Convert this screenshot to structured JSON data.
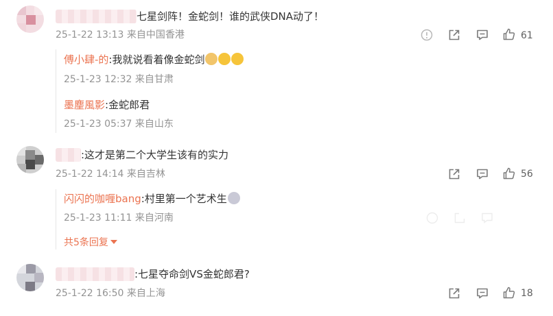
{
  "comments": [
    {
      "text": "七星剑阵！金蛇剑！谁的武侠DNA动了！",
      "meta": "25-1-22 13:13 来自中国香港",
      "likes": "61",
      "replies": [
        {
          "name": "傅小肆-的",
          "text": ":我就说看着像金蛇剑",
          "meta": "25-1-23 12:32 来自甘肃"
        },
        {
          "name": "墨麈風影",
          "text": ":金蛇郎君",
          "meta": "25-1-23 05:37 来自山东"
        }
      ]
    },
    {
      "text": ":这才是第二个大学生该有的实力",
      "meta": "25-1-22 14:14 来自吉林",
      "likes": "56",
      "replies": [
        {
          "name": "闪闪的咖喱bang",
          "text": ":村里第一个艺术生",
          "meta": "25-1-23 11:11 来自河南"
        }
      ],
      "more_replies": "共5条回复"
    },
    {
      "text": ":七星夺命剑VS金蛇郎君?",
      "meta": "25-1-22 16:50 来自上海",
      "likes": "18"
    }
  ],
  "colors": {
    "accent": "#eb7350",
    "meta": "#939393",
    "icon": "#7a7a7a",
    "divider": "#e6e6e6"
  },
  "icons": [
    "report-icon",
    "share-icon",
    "comment-icon",
    "like-icon",
    "chevron-down-icon"
  ]
}
